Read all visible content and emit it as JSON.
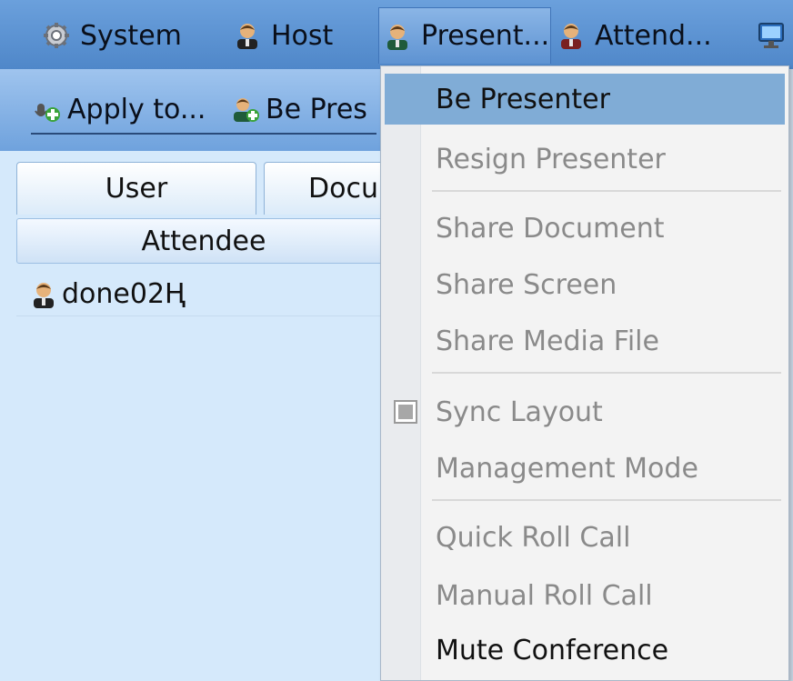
{
  "menubar": {
    "items": [
      {
        "label": "System",
        "icon": "gear-icon"
      },
      {
        "label": "Host",
        "icon": "user-icon"
      },
      {
        "label": "Present...",
        "icon": "presenter-icon"
      },
      {
        "label": "Attend...",
        "icon": "attendee-icon"
      },
      {
        "label": "",
        "icon": "monitor-icon"
      }
    ]
  },
  "toolbar": {
    "items": [
      {
        "label": "Apply to...",
        "icon": "apply-speak-icon"
      },
      {
        "label": "Be Pres",
        "icon": "be-presenter-icon"
      }
    ]
  },
  "panel": {
    "tabs": [
      "User",
      "Docu"
    ],
    "list_header": "Attendee",
    "users": [
      {
        "name": "done02Ⱨ",
        "icon": "user-icon"
      }
    ]
  },
  "dropdown": {
    "items": [
      {
        "label": "Be Presenter",
        "enabled": true,
        "highlight": true
      },
      {
        "label": "Resign Presenter",
        "enabled": false
      },
      {
        "label": "Share Document",
        "enabled": false
      },
      {
        "label": "Share Screen",
        "enabled": false
      },
      {
        "label": "Share Media File",
        "enabled": false
      },
      {
        "label": "Sync Layout",
        "enabled": false,
        "checkbox": true
      },
      {
        "label": "Management Mode",
        "enabled": false
      },
      {
        "label": "Quick Roll Call",
        "enabled": false
      },
      {
        "label": "Manual Roll Call",
        "enabled": false
      },
      {
        "label": "Mute Conference",
        "enabled": true
      }
    ]
  },
  "colors": {
    "menubar": "#5b92d3",
    "highlight": "#80acd6",
    "panel_bg": "#d5e9fb",
    "disabled_text": "#8a8a8a"
  }
}
